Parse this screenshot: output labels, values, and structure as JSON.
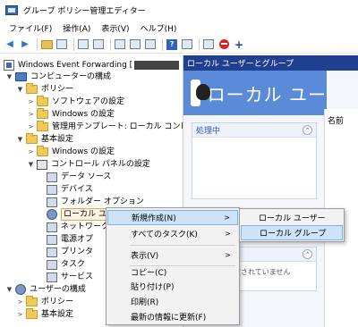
{
  "window": {
    "title": "グループ ポリシー管理エディター"
  },
  "menu": [
    "ファイル(F)",
    "操作(A)",
    "表示(V)",
    "ヘルプ(H)"
  ],
  "tree": {
    "root": "Windows Event Forwarding [",
    "computer_config": "コンピューターの構成",
    "policies": "ポリシー",
    "software_settings": "ソフトウェアの設定",
    "windows_settings": "Windows の設定",
    "admin_templates": "管理用テンプレート: ローカル コンピュー",
    "preferences": "基本設定",
    "pref_windows_settings": "Windows の設定",
    "control_panel": "コントロール パネルの設定",
    "data_sources": "データ ソース",
    "devices": "デバイス",
    "folder_options": "フォルダー オプション",
    "local_users_groups": "ローカル ユーザーとグループ",
    "network": "ネットワーク",
    "power": "電源オプ",
    "printers": "プリンタ",
    "tasks": "タスク",
    "services": "サービス",
    "user_config": "ユーザーの構成",
    "user_policies": "ポリシー",
    "user_preferences": "基本設定"
  },
  "right": {
    "header": "ローカル ユーザーとグループ",
    "banner": "ローカル ユー",
    "column_name": "名前",
    "processing_panel": "処理中",
    "lower_panel_text": "定されていません"
  },
  "context_menu": {
    "new": "新規作成(N)",
    "all_tasks": "すべてのタスク(K)",
    "view": "表示(V)",
    "copy": "コピー(C)",
    "paste": "貼り付け(P)",
    "print": "印刷(R)",
    "refresh": "最新の情報に更新(F)"
  },
  "submenu": {
    "local_user": "ローカル ユーザー",
    "local_group": "ローカル グループ"
  },
  "colors": {
    "accent": "#1f3f8f",
    "banner": "#5b8bd8",
    "highlight": "#cfe3f8"
  }
}
